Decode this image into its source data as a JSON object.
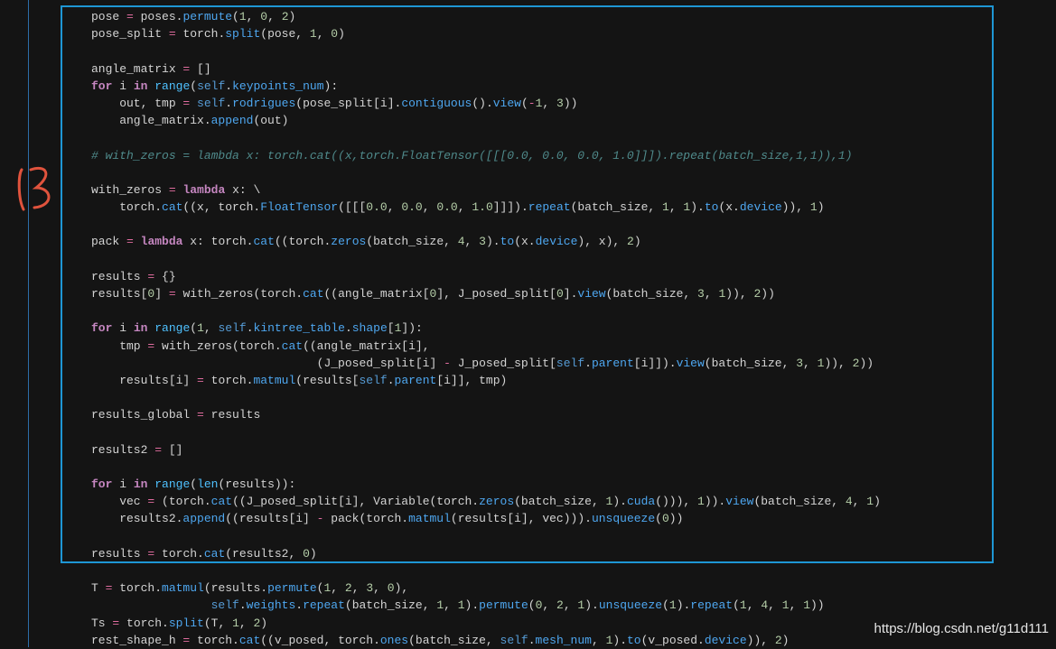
{
  "code_lines": [
    "pose = poses.permute(1, 0, 2)",
    "pose_split = torch.split(pose, 1, 0)",
    "",
    "angle_matrix = []",
    "for i in range(self.keypoints_num):",
    "    out, tmp = self.rodrigues(pose_split[i].contiguous().view(-1, 3))",
    "    angle_matrix.append(out)",
    "",
    "# with_zeros = lambda x: torch.cat((x,torch.FloatTensor([[[0.0, 0.0, 0.0, 1.0]]]).repeat(batch_size,1,1)),1)",
    "",
    "with_zeros = lambda x: \\",
    "    torch.cat((x, torch.FloatTensor([[[0.0, 0.0, 0.0, 1.0]]]).repeat(batch_size, 1, 1).to(x.device)), 1)",
    "",
    "pack = lambda x: torch.cat((torch.zeros(batch_size, 4, 3).to(x.device), x), 2)",
    "",
    "results = {}",
    "results[0] = with_zeros(torch.cat((angle_matrix[0], J_posed_split[0].view(batch_size, 3, 1)), 2))",
    "",
    "for i in range(1, self.kintree_table.shape[1]):",
    "    tmp = with_zeros(torch.cat((angle_matrix[i],",
    "                                (J_posed_split[i] - J_posed_split[self.parent[i]]).view(batch_size, 3, 1)), 2))",
    "    results[i] = torch.matmul(results[self.parent[i]], tmp)",
    "",
    "results_global = results",
    "",
    "results2 = []",
    "",
    "for i in range(len(results)):",
    "    vec = (torch.cat((J_posed_split[i], Variable(torch.zeros(batch_size, 1).cuda())), 1)).view(batch_size, 4, 1)",
    "    results2.append((results[i] - pack(torch.matmul(results[i], vec))).unsqueeze(0))",
    "",
    "results = torch.cat(results2, 0)",
    "",
    "T = torch.matmul(results.permute(1, 2, 3, 0),",
    "                 self.weights.repeat(batch_size, 1, 1).permute(0, 2, 1).unsqueeze(1).repeat(1, 4, 1, 1))",
    "Ts = torch.split(T, 1, 2)",
    "rest_shape_h = torch.cat((v_posed, torch.ones(batch_size, self.mesh_num, 1).to(v_posed.device)), 2)"
  ],
  "watermark": "https://blog.csdn.net/g11d111",
  "colors": {
    "highlight_box": "#1e96d4",
    "annotation": "#e0533d",
    "keyword": "#c586c0",
    "function": "#4ea7f0",
    "number": "#b5cea8",
    "comment": "#4f8a8b"
  }
}
